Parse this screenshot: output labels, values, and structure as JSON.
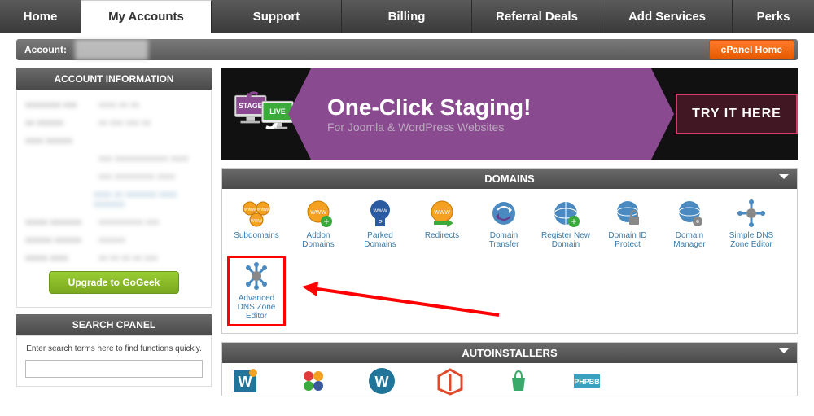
{
  "tabs": {
    "home": "Home",
    "my_accounts": "My Accounts",
    "support": "Support",
    "billing": "Billing",
    "referral": "Referral Deals",
    "add_services": "Add Services",
    "perks": "Perks"
  },
  "account_bar": {
    "label": "Account:",
    "cpanel_home": "cPanel Home"
  },
  "sidebar": {
    "account_info_title": "ACCOUNT INFORMATION",
    "upgrade_label": "Upgrade to GoGeek",
    "search_title": "SEARCH CPANEL",
    "search_hint": "Enter search terms here to find functions quickly."
  },
  "banner": {
    "stage": "STAGE",
    "live": "LIVE",
    "title": "One-Click Staging!",
    "subtitle": "For Joomla & WordPress Websites",
    "cta": "TRY IT HERE"
  },
  "sections": {
    "domains": {
      "title": "DOMAINS",
      "items": [
        "Subdomains",
        "Addon Domains",
        "Parked Domains",
        "Redirects",
        "Domain Transfer",
        "Register New Domain",
        "Domain ID Protect",
        "Domain Manager",
        "Simple DNS Zone Editor",
        "Advanced DNS Zone Editor"
      ]
    },
    "autoinstallers": {
      "title": "AUTOINSTALLERS"
    }
  },
  "colors": {
    "accent_orange": "#e55a00",
    "accent_purple": "#8a4a8f",
    "accent_green": "#7aa820",
    "link": "#3a7aa8",
    "highlight": "#ff0000"
  }
}
